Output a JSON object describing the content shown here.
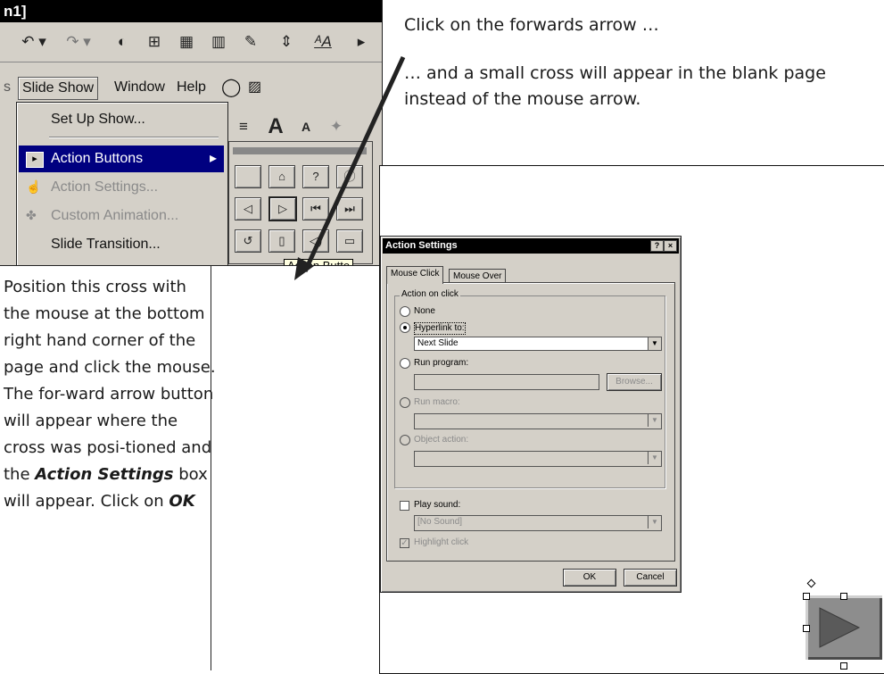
{
  "app": {
    "title_fragment": "n1]",
    "menu": {
      "items": [
        "Slide Show",
        "Window",
        "Help"
      ],
      "active": "Slide Show"
    },
    "slide_show_menu": {
      "items": [
        {
          "label": "Set Up Show...",
          "state": "normal",
          "icon": "none"
        },
        {
          "label": "Action Buttons",
          "state": "highlighted",
          "icon": "action-buttons-icon",
          "submenu": true
        },
        {
          "label": "Action Settings...",
          "state": "disabled",
          "icon": "hand-pointer-icon"
        },
        {
          "label": "Custom Animation...",
          "state": "disabled",
          "icon": "animation-icon"
        },
        {
          "label": "Slide Transition...",
          "state": "normal",
          "icon": "none"
        }
      ]
    },
    "action_buttons_grid": [
      [
        "blank-button-icon",
        "home-button-icon",
        "help-button-icon",
        "information-button-icon"
      ],
      [
        "back-button-icon",
        "forward-button-icon",
        "beginning-button-icon",
        "end-button-icon"
      ],
      [
        "return-button-icon",
        "document-button-icon",
        "sound-button-icon",
        "movie-button-icon"
      ]
    ],
    "selected_action_button": "forward-button-icon",
    "tooltip": "Action Butto"
  },
  "captions": {
    "step1": "Click on the forwards arrow …",
    "step2": "… and a small cross will appear in the blank page instead of the mouse arrow.",
    "step3_a": "Position this cross with the mouse at the bottom right hand corner of the page and click the mouse. The for-ward arrow button will appear where the cross was posi-tioned and the ",
    "step3_italic": "Action Settings",
    "step3_b": " box will appear. Click on ",
    "step3_ok": "OK"
  },
  "dialog": {
    "title": "Action Settings",
    "help_btn": "?",
    "close_btn": "×",
    "tabs": [
      "Mouse Click",
      "Mouse Over"
    ],
    "active_tab": "Mouse Click",
    "group_label": "Action on click",
    "options": {
      "none": "None",
      "hyperlink": "Hyperlink to:",
      "run_program": "Run program:",
      "run_macro": "Run macro:",
      "object_action": "Object action:"
    },
    "selected_option": "hyperlink",
    "hyperlink_value": "Next Slide",
    "browse_label": "Browse...",
    "play_sound_label": "Play sound:",
    "sound_value": "[No Sound]",
    "highlight_label": "Highlight click",
    "ok_label": "OK",
    "cancel_label": "Cancel"
  }
}
